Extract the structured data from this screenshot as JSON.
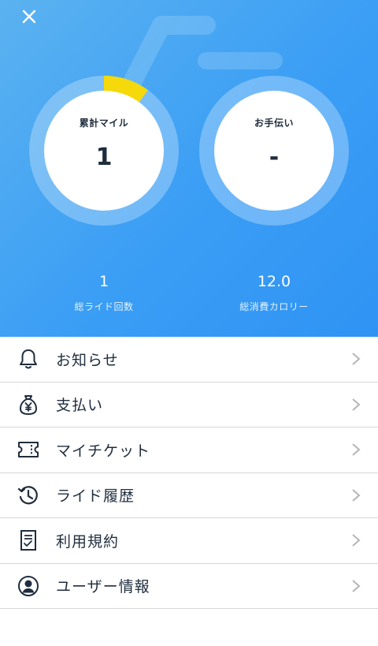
{
  "header": {
    "close_icon": "close-icon",
    "background_color": "#3b9ef5"
  },
  "gauges": [
    {
      "label": "累計マイル",
      "value": "1",
      "progress": 0.1,
      "progress_color": "#f5d90a"
    },
    {
      "label": "お手伝い",
      "value": "-",
      "progress": 0
    }
  ],
  "stats": [
    {
      "value": "1",
      "label": "総ライド回数"
    },
    {
      "value": "12.0",
      "label": "総消費カロリー"
    }
  ],
  "menu": {
    "items": [
      {
        "label": "お知らせ",
        "icon": "bell-icon"
      },
      {
        "label": "支払い",
        "icon": "money-bag-icon"
      },
      {
        "label": "マイチケット",
        "icon": "ticket-icon"
      },
      {
        "label": "ライド履歴",
        "icon": "history-icon"
      },
      {
        "label": "利用規約",
        "icon": "terms-document-icon"
      },
      {
        "label": "ユーザー情報",
        "icon": "user-icon"
      }
    ],
    "chevron_icon": "chevron-right-icon"
  }
}
